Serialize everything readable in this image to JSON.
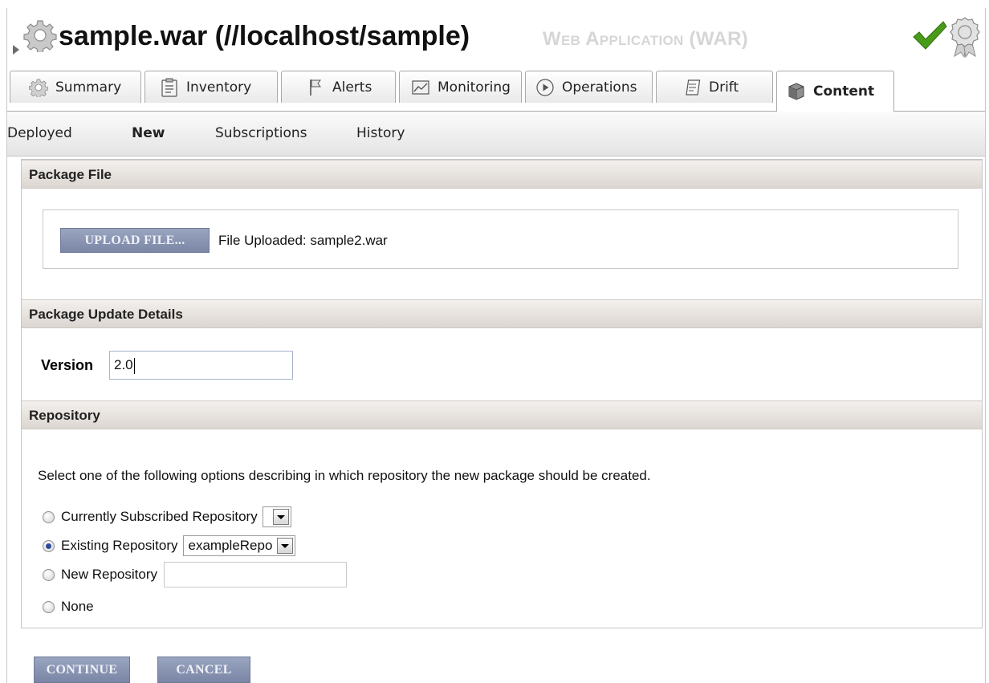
{
  "header": {
    "title": "sample.war (//localhost/sample)",
    "subtitle": "Web Application (WAR)",
    "status_icon": "checkmark-icon",
    "badge_icon": "award-icon"
  },
  "tabs": [
    {
      "label": "Summary",
      "icon": "gear-icon"
    },
    {
      "label": "Inventory",
      "icon": "clipboard-icon"
    },
    {
      "label": "Alerts",
      "icon": "flag-icon"
    },
    {
      "label": "Monitoring",
      "icon": "chart-icon"
    },
    {
      "label": "Operations",
      "icon": "play-icon"
    },
    {
      "label": "Drift",
      "icon": "document-icon"
    },
    {
      "label": "Content",
      "icon": "box-icon",
      "active": true
    }
  ],
  "subtabs": [
    {
      "label": "Deployed"
    },
    {
      "label": "New",
      "active": true
    },
    {
      "label": "Subscriptions"
    },
    {
      "label": "History"
    }
  ],
  "package_file": {
    "heading": "Package File",
    "upload_label": "UPLOAD FILE...",
    "status": "File Uploaded: sample2.war"
  },
  "update_details": {
    "heading": "Package Update Details",
    "version_label": "Version",
    "version_value": "2.0"
  },
  "repository": {
    "heading": "Repository",
    "description": "Select one of the following options describing in which repository the new package should be created.",
    "options": [
      {
        "label": "Currently Subscribed Repository",
        "selected": false,
        "select_value": ""
      },
      {
        "label": "Existing Repository",
        "selected": true,
        "select_value": "exampleRepo"
      },
      {
        "label": "New Repository",
        "selected": false
      },
      {
        "label": "None",
        "selected": false
      }
    ]
  },
  "actions": {
    "continue_label": "CONTINUE",
    "cancel_label": "CANCEL"
  },
  "colors": {
    "button": "#8590ae",
    "check": "#4a9a1a",
    "section_header": "#e3ddd8",
    "radio_selected": "#2c4c9c"
  }
}
